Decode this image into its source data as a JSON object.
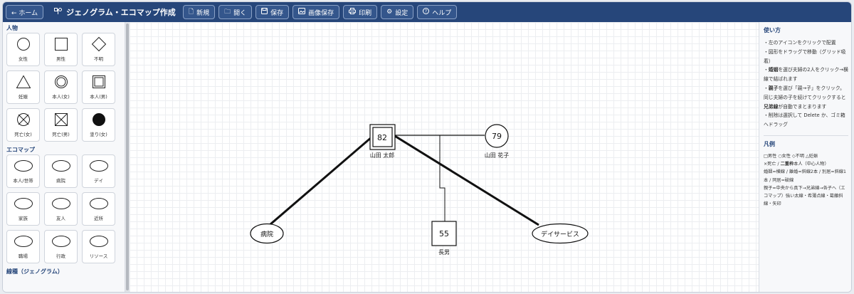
{
  "toolbar": {
    "home_label": "← ホーム",
    "title": "ジェノグラム・エコマップ作成",
    "buttons": [
      {
        "icon": "file-icon",
        "glyph": "🗋",
        "label": "新規"
      },
      {
        "icon": "folder-icon",
        "glyph": "🗀",
        "label": "開く"
      },
      {
        "icon": "save-icon",
        "glyph": "💾",
        "label": "保存"
      },
      {
        "icon": "image-icon",
        "glyph": "🖼",
        "label": "画像保存"
      },
      {
        "icon": "print-icon",
        "glyph": "🖶",
        "label": "印刷"
      },
      {
        "icon": "gear-icon",
        "glyph": "⚙",
        "label": "設定"
      },
      {
        "icon": "help-icon",
        "glyph": "?",
        "label": "ヘルプ"
      }
    ]
  },
  "left": {
    "people_title": "人物",
    "people": [
      "女性",
      "男性",
      "不明",
      "妊娠",
      "本人(女)",
      "本人(男)",
      "死亡(女)",
      "死亡(男)",
      "塗り(女)"
    ],
    "ecomap_title": "エコマップ",
    "ecomap": [
      "本人/世帯",
      "病院",
      "デイ",
      "家族",
      "友人",
      "近所",
      "職場",
      "行政",
      "リソース"
    ],
    "lines_title": "線種（ジェノグラム）"
  },
  "canvas": {
    "self_age": "82",
    "self_name": "山田 太郎",
    "wife_age": "79",
    "wife_name": "山田 花子",
    "son_age": "55",
    "son_name": "長男",
    "hospital": "病院",
    "day_service": "デイサービス"
  },
  "right": {
    "usage_title": "使い方",
    "usage_1": "・左のアイコンをクリックで配置",
    "usage_2": "・図形をドラッグで移動（グリッド吸着）",
    "usage_3a": "・",
    "usage_3b": "婚姻",
    "usage_3c": "を選び夫婦の2人をクリック→横線で結ばれます",
    "usage_4a": "・",
    "usage_4b": "親子",
    "usage_4c": "を選び「親→子」をクリック。同じ夫婦の子を続けてクリックすると",
    "usage_4d": "兄弟線",
    "usage_4e": "が自動でまとまります",
    "usage_5": "・削除は選択して Delete か、ゴミ箱へドラッグ",
    "legend_title": "凡例",
    "legend_1": "□男性 ○女性 ◇不明 △妊娠",
    "legend_2a": "×死亡 / ",
    "legend_2b": "二重枠",
    "legend_2c": "本人（中心人物）",
    "legend_3": "婚姻=横線 / 離婚=斜線2本 / 別居=斜線1本 / 同居=破線",
    "legend_4": "親子=中央から真下→兄弟線→各子へ（エコマップ）強い太線・希薄点線・葛藤斜線・矢印"
  }
}
